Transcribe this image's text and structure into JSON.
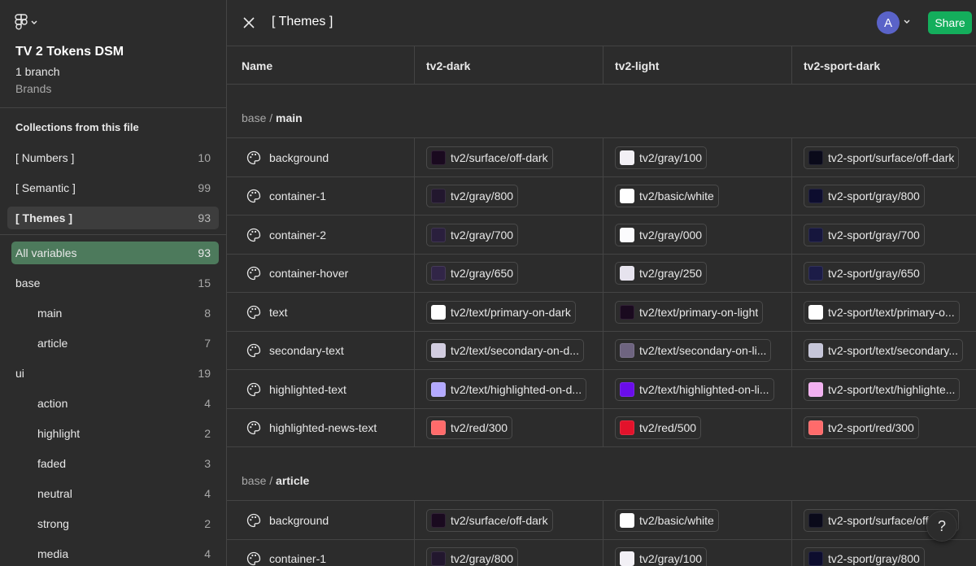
{
  "sidebar": {
    "file_title": "TV 2 Tokens DSM",
    "branch": "1 branch",
    "project": "Brands",
    "collections_heading": "Collections from this file",
    "collections": [
      {
        "label": "[ Numbers ]",
        "count": "10"
      },
      {
        "label": "[ Semantic ]",
        "count": "99"
      },
      {
        "label": "[ Themes ]",
        "count": "93"
      }
    ],
    "groups": [
      {
        "label": "All variables",
        "count": "93"
      },
      {
        "label": "base",
        "count": "15"
      },
      {
        "label": "main",
        "count": "8"
      },
      {
        "label": "article",
        "count": "7"
      },
      {
        "label": "ui",
        "count": "19"
      },
      {
        "label": "action",
        "count": "4"
      },
      {
        "label": "highlight",
        "count": "2"
      },
      {
        "label": "faded",
        "count": "3"
      },
      {
        "label": "neutral",
        "count": "4"
      },
      {
        "label": "strong",
        "count": "2"
      },
      {
        "label": "media",
        "count": "4"
      }
    ]
  },
  "header": {
    "title": "[ Themes ]",
    "avatar_letter": "A",
    "share_label": "Share"
  },
  "table": {
    "columns": [
      "Name",
      "tv2-dark",
      "tv2-light",
      "tv2-sport-dark"
    ],
    "groups": [
      {
        "prefix": "base / ",
        "name": "main",
        "rows": [
          {
            "name": "background",
            "cells": [
              {
                "label": "tv2/surface/off-dark",
                "color": "#1a0a1f"
              },
              {
                "label": "tv2/gray/100",
                "color": "#f2f0f5"
              },
              {
                "label": "tv2-sport/surface/off-dark",
                "color": "#0a0a1a"
              }
            ]
          },
          {
            "name": "container-1",
            "cells": [
              {
                "label": "tv2/gray/800",
                "color": "#22172e"
              },
              {
                "label": "tv2/basic/white",
                "color": "#ffffff"
              },
              {
                "label": "tv2-sport/gray/800",
                "color": "#0d0d2e"
              }
            ]
          },
          {
            "name": "container-2",
            "cells": [
              {
                "label": "tv2/gray/700",
                "color": "#2a1f3d"
              },
              {
                "label": "tv2/gray/000",
                "color": "#fbfbfd"
              },
              {
                "label": "tv2-sport/gray/700",
                "color": "#16163d"
              }
            ]
          },
          {
            "name": "container-hover",
            "cells": [
              {
                "label": "tv2/gray/650",
                "color": "#312547"
              },
              {
                "label": "tv2/gray/250",
                "color": "#e6e3ee"
              },
              {
                "label": "tv2-sport/gray/650",
                "color": "#1c1c47"
              }
            ]
          },
          {
            "name": "text",
            "cells": [
              {
                "label": "tv2/text/primary-on-dark",
                "color": "#ffffff"
              },
              {
                "label": "tv2/text/primary-on-light",
                "color": "#1a0a1f"
              },
              {
                "label": "tv2-sport/text/primary-o...",
                "color": "#ffffff"
              }
            ]
          },
          {
            "name": "secondary-text",
            "cells": [
              {
                "label": "tv2/text/secondary-on-d...",
                "color": "#d2cde0"
              },
              {
                "label": "tv2/text/secondary-on-li...",
                "color": "#6e6480"
              },
              {
                "label": "tv2-sport/text/secondary...",
                "color": "#c5c5d8"
              }
            ]
          },
          {
            "name": "highlighted-text",
            "cells": [
              {
                "label": "tv2/text/highlighted-on-d...",
                "color": "#b3a9ff"
              },
              {
                "label": "tv2/text/highlighted-on-li...",
                "color": "#6a0dea"
              },
              {
                "label": "tv2-sport/text/highlighte...",
                "color": "#f2b0f0"
              }
            ]
          },
          {
            "name": "highlighted-news-text",
            "cells": [
              {
                "label": "tv2/red/300",
                "color": "#ff6b6b"
              },
              {
                "label": "tv2/red/500",
                "color": "#e3122b"
              },
              {
                "label": "tv2-sport/red/300",
                "color": "#ff6b6b"
              }
            ]
          }
        ]
      },
      {
        "prefix": "base / ",
        "name": "article",
        "rows": [
          {
            "name": "background",
            "cells": [
              {
                "label": "tv2/surface/off-dark",
                "color": "#1a0a1f"
              },
              {
                "label": "tv2/basic/white",
                "color": "#ffffff"
              },
              {
                "label": "tv2-sport/surface/off-dark",
                "color": "#0a0a1a"
              }
            ]
          },
          {
            "name": "container-1",
            "cells": [
              {
                "label": "tv2/gray/800",
                "color": "#22172e"
              },
              {
                "label": "tv2/gray/100",
                "color": "#f2f0f5"
              },
              {
                "label": "tv2-sport/gray/800",
                "color": "#0d0d2e"
              }
            ]
          }
        ]
      }
    ]
  },
  "help_label": "?"
}
